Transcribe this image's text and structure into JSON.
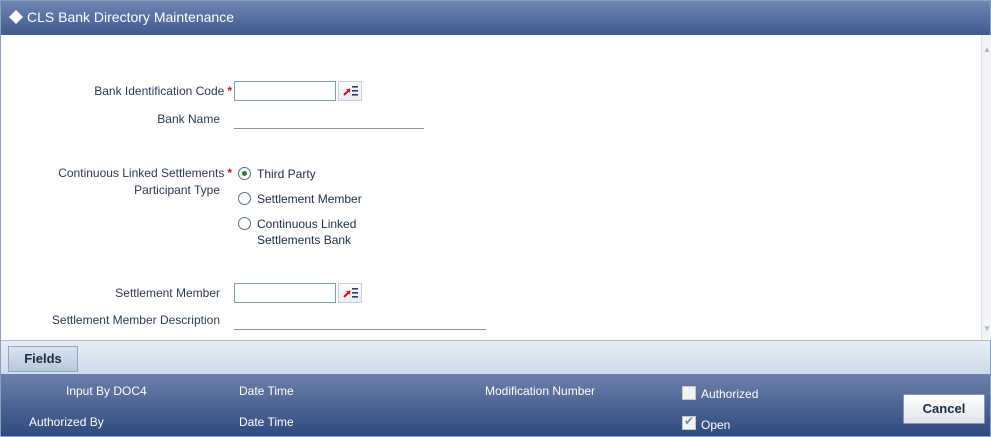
{
  "window": {
    "title": "CLS Bank Directory Maintenance"
  },
  "form": {
    "bic": {
      "label": "Bank Identification Code",
      "required_mark": "*",
      "value": ""
    },
    "bank_name": {
      "label": "Bank Name",
      "value": ""
    },
    "participant_type": {
      "label_line1": "Continuous Linked Settlements",
      "label_line2": "Participant Type",
      "required_mark": "*",
      "options": [
        {
          "label": "Third Party",
          "selected": true
        },
        {
          "label": "Settlement Member",
          "selected": false
        },
        {
          "label_line1": "Continuous Linked",
          "label_line2": "Settlements Bank",
          "selected": false
        }
      ]
    },
    "settlement_member": {
      "label": "Settlement Member",
      "value": ""
    },
    "settlement_member_description": {
      "label": "Settlement Member Description",
      "value": ""
    }
  },
  "tabs": [
    {
      "label": "Fields"
    }
  ],
  "footer": {
    "input_by": "Input By DOC4",
    "authorized_by": "Authorized By",
    "date_time_1": "Date Time",
    "date_time_2": "Date Time",
    "modification_number": "Modification Number",
    "authorized": {
      "label": "Authorized",
      "checked": false
    },
    "open": {
      "label": "Open",
      "checked": true
    },
    "cancel_label": "Cancel"
  },
  "colors": {
    "title_bar": "#3f5a8e",
    "footer": "#2f4a7e",
    "required": "#d0121b"
  }
}
